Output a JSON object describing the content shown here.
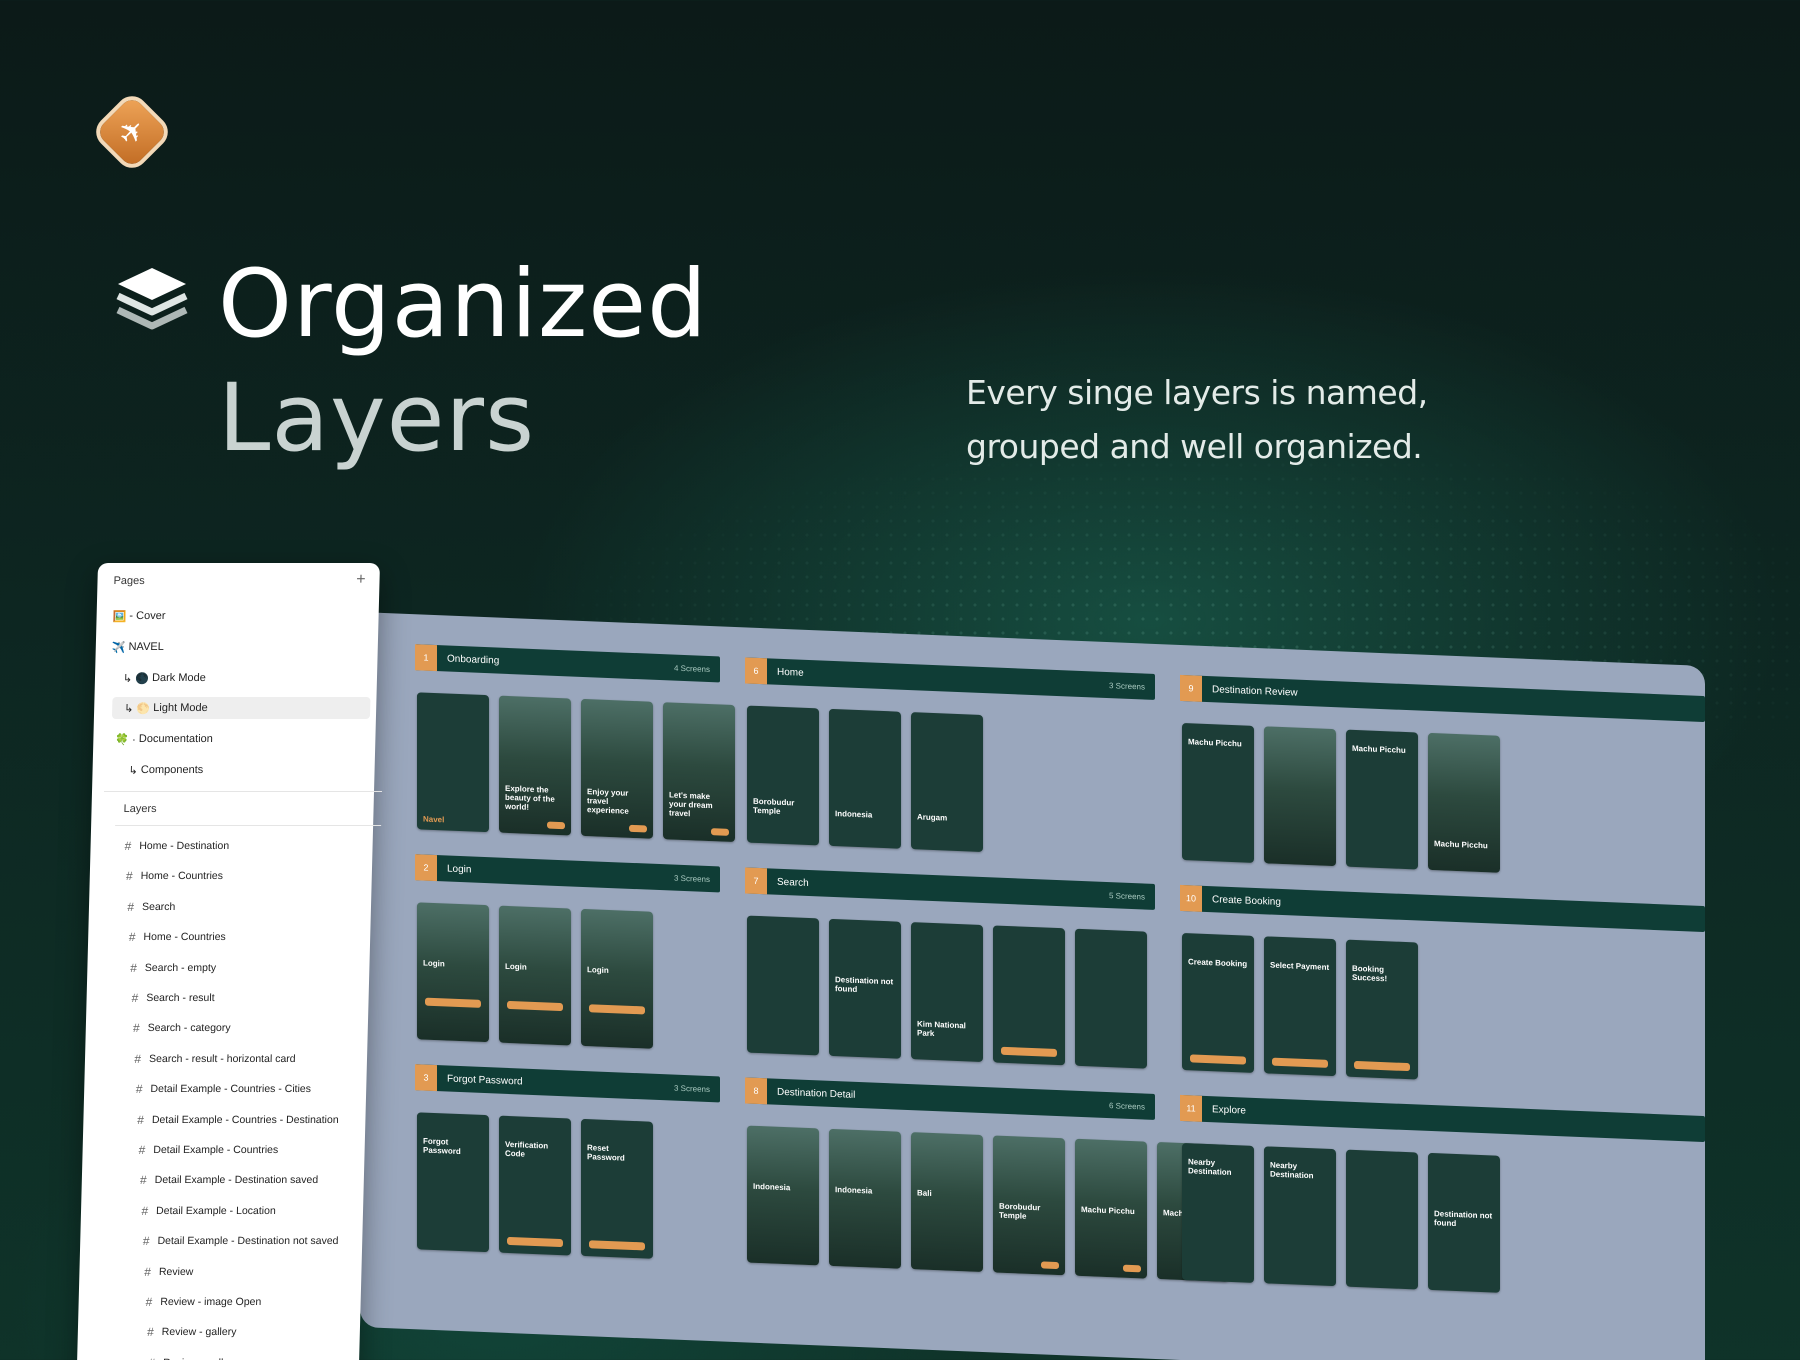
{
  "title_line1": "Organized",
  "title_line2": "Layers",
  "subtitle": "Every singe layers is named, grouped and well organized.",
  "pages_panel": {
    "header": "Pages",
    "add_icon": "+",
    "pages": [
      {
        "icon": "🖼️",
        "label": "- Cover"
      },
      {
        "icon": "✈️",
        "label": "NAVEL"
      },
      {
        "icon": "↳ 🌑",
        "label": "Dark Mode"
      },
      {
        "icon": "↳ 🌕",
        "label": "Light Mode"
      },
      {
        "icon": "🍀 ·",
        "label": "Documentation"
      },
      {
        "icon": "↳",
        "label": "Components"
      }
    ],
    "layers_header": "Layers",
    "layers": [
      "Home - Destination",
      "Home - Countries",
      "Search",
      "Home - Countries",
      "Search - empty",
      "Search - result",
      "Search - category",
      "Search - result - horizontal card",
      "Detail Example - Countries - Cities",
      "Detail Example - Countries - Destination",
      "Detail Example - Countries",
      "Detail Example - Destination saved",
      "Detail Example - Location",
      "Detail Example - Destination not saved",
      "Review",
      "Review - image Open",
      "Review - gallery",
      "Review - gallery - open"
    ]
  },
  "sections": [
    {
      "num": "1",
      "name": "Onboarding",
      "count": "4 Screens",
      "screen_texts": [
        "Navel",
        "Explore the beauty of the world!",
        "Enjoy your travel experience",
        "Let's make your dream travel"
      ]
    },
    {
      "num": "2",
      "name": "Login",
      "count": "3 Screens",
      "screen_texts": [
        "Login",
        "Login",
        "Login"
      ]
    },
    {
      "num": "3",
      "name": "Forgot Password",
      "count": "3 Screens",
      "screen_texts": [
        "Forgot Password",
        "Verification Code",
        "Reset Password"
      ]
    },
    {
      "num": "6",
      "name": "Home",
      "count": "3 Screens",
      "screen_texts": [
        "Borobudur Temple",
        "Indonesia",
        "Arugam"
      ]
    },
    {
      "num": "7",
      "name": "Search",
      "count": "5 Screens",
      "screen_texts": [
        "",
        "Destination not found",
        "Kim National Park",
        "",
        ""
      ]
    },
    {
      "num": "8",
      "name": "Destination Detail",
      "count": "6 Screens",
      "screen_texts": [
        "Indonesia",
        "Indonesia",
        "Bali",
        "Borobudur Temple",
        "Machu Picchu",
        "Machu Picchu"
      ]
    },
    {
      "num": "9",
      "name": "Destination Review",
      "count": "",
      "screen_texts": [
        "Machu Picchu",
        "",
        "Machu Picchu",
        "Machu Picchu"
      ]
    },
    {
      "num": "10",
      "name": "Create Booking",
      "count": "",
      "screen_texts": [
        "Create Booking",
        "Select Payment",
        "Booking Success!"
      ]
    },
    {
      "num": "11",
      "name": "Explore",
      "count": "",
      "screen_texts": [
        "Nearby Destination",
        "Nearby Destination",
        "",
        "Destination not found"
      ]
    }
  ]
}
